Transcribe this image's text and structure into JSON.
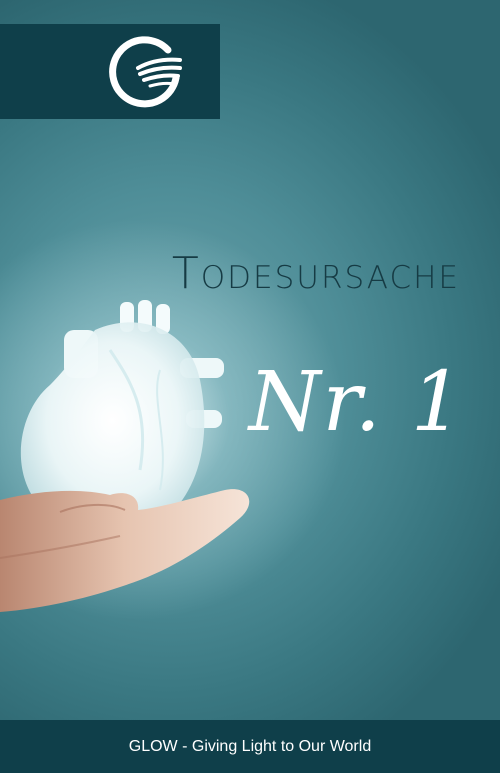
{
  "cover": {
    "title_line1": "Todesursache",
    "title_line2": "Nr. 1",
    "footer_text": "GLOW - Giving Light to Our World"
  },
  "colors": {
    "logo_background": "#0f3f4a",
    "footer_background": "#0f3f4a",
    "title_line1": "#163b44",
    "title_line2": "#ffffff"
  },
  "icons": {
    "logo": "glow-logo-icon",
    "illustration": "hand-holding-heart"
  }
}
